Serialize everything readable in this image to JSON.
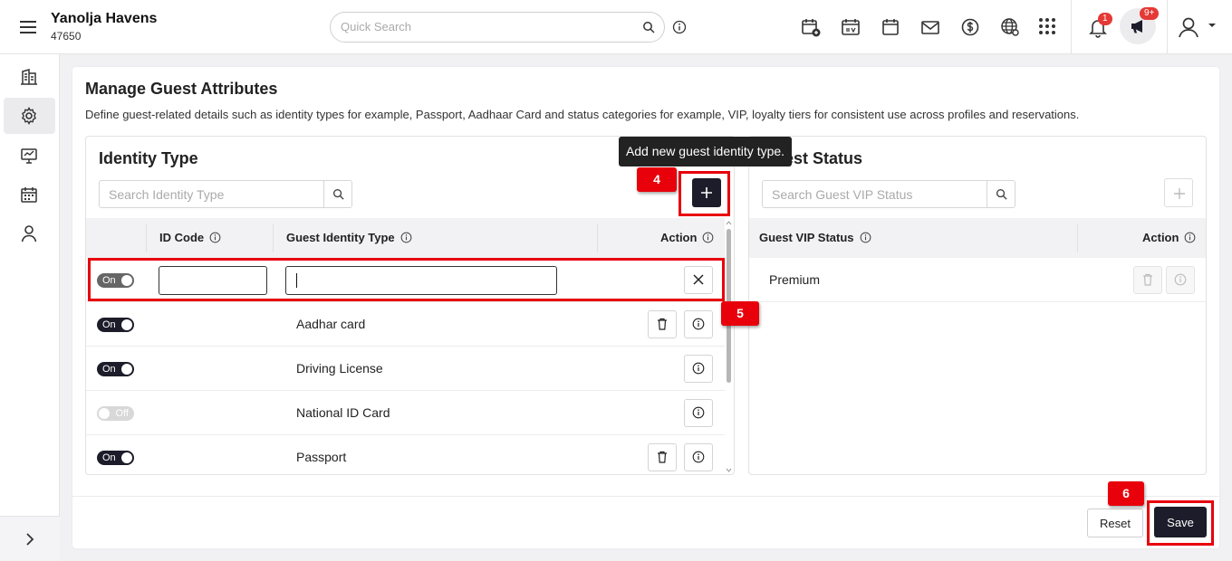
{
  "header": {
    "property_name": "Yanolja Havens",
    "property_id": "47650",
    "search_placeholder": "Quick Search",
    "notification_count": "1",
    "announcement_count": "9+"
  },
  "page": {
    "title": "Manage Guest Attributes",
    "description": "Define guest-related details such as identity types for example, Passport, Aadhaar Card and status categories for example, VIP, loyalty tiers for consistent use across profiles and reservations."
  },
  "identity": {
    "title": "Identity Type",
    "search_placeholder": "Search Identity Type",
    "tooltip": "Add new guest identity type.",
    "columns": {
      "code": "ID Code",
      "type": "Guest Identity Type",
      "action": "Action"
    },
    "new_row": {
      "toggle": "On",
      "code": "",
      "type": ""
    },
    "rows": [
      {
        "status": "On",
        "code": "",
        "name": "Aadhar card",
        "deletable": true
      },
      {
        "status": "On",
        "code": "",
        "name": "Driving License",
        "deletable": false
      },
      {
        "status": "Off",
        "code": "",
        "name": "National ID Card",
        "deletable": false
      },
      {
        "status": "On",
        "code": "",
        "name": "Passport",
        "deletable": true
      }
    ]
  },
  "status": {
    "title": "Guest Status",
    "search_placeholder": "Search Guest VIP Status",
    "columns": {
      "status": "Guest VIP Status",
      "action": "Action"
    },
    "rows": [
      {
        "name": "Premium"
      }
    ]
  },
  "footer": {
    "reset": "Reset",
    "save": "Save"
  },
  "callouts": [
    "4",
    "5",
    "6"
  ],
  "colors": {
    "accent": "#1c1c2a",
    "highlight": "#e8000b",
    "badge": "#e53935"
  }
}
